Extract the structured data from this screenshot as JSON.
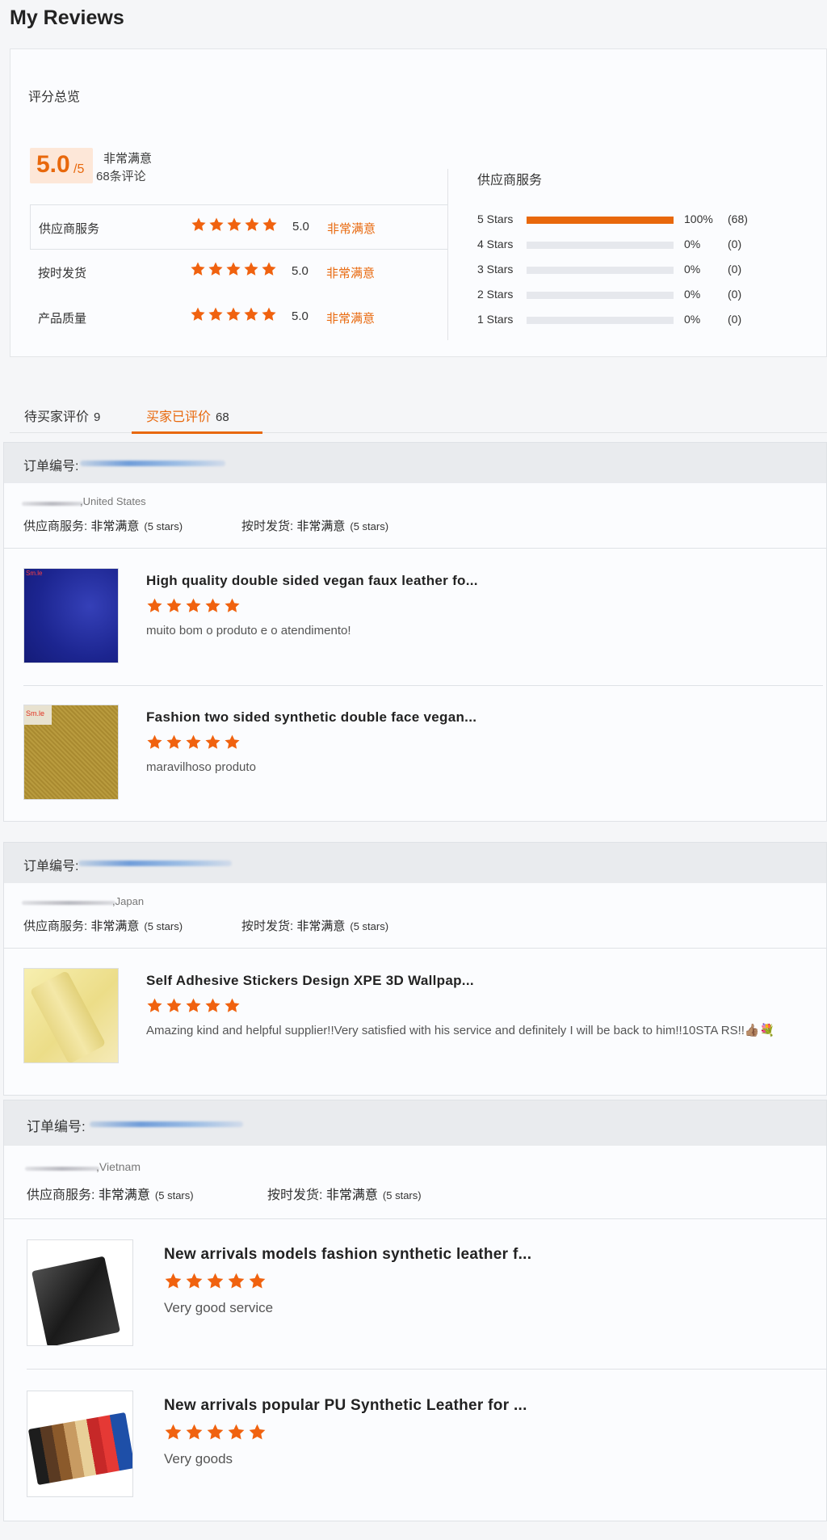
{
  "page": {
    "title": "My Reviews"
  },
  "overview": {
    "heading": "评分总览",
    "score": "5.0",
    "score_max": "/5",
    "score_text": "非常满意",
    "review_count": "68条评论",
    "rows": [
      {
        "label": "供应商服务",
        "score": "5.0",
        "status": "非常满意",
        "stars": 5
      },
      {
        "label": "按时发货",
        "score": "5.0",
        "status": "非常满意",
        "stars": 5
      },
      {
        "label": "产品质量",
        "score": "5.0",
        "status": "非常满意",
        "stars": 5
      }
    ],
    "distribution_title": "供应商服务",
    "distribution": [
      {
        "label": "5 Stars",
        "percent": "100%",
        "count": "(68)",
        "fraction": 1.0
      },
      {
        "label": "4 Stars",
        "percent": "0%",
        "count": "(0)",
        "fraction": 0
      },
      {
        "label": "3 Stars",
        "percent": "0%",
        "count": "(0)",
        "fraction": 0
      },
      {
        "label": "2 Stars",
        "percent": "0%",
        "count": "(0)",
        "fraction": 0
      },
      {
        "label": "1 Stars",
        "percent": "0%",
        "count": "(0)",
        "fraction": 0
      }
    ]
  },
  "tabs": [
    {
      "label": "待买家评价",
      "count": "9",
      "active": false
    },
    {
      "label": "买家已评价",
      "count": "68",
      "active": true
    }
  ],
  "orders": [
    {
      "order_label": "订单编号:",
      "country": "United States",
      "supplier_service_key": "供应商服务:",
      "supplier_service_val": "非常满意",
      "supplier_service_stars": "(5 stars)",
      "on_time_key": "按时发货:",
      "on_time_val": "非常满意",
      "on_time_stars": "(5 stars)",
      "products": [
        {
          "title": "High quality double sided vegan faux leather fo...",
          "stars": 5,
          "comment": "muito bom o produto e o atendimento!",
          "thumb_label": "Sm.le"
        },
        {
          "title": "Fashion two sided synthetic double face vegan...",
          "stars": 5,
          "comment": "maravilhoso produto",
          "thumb_label": "Sm.le"
        }
      ]
    },
    {
      "order_label": "订单编号:",
      "country": "Japan",
      "supplier_service_key": "供应商服务:",
      "supplier_service_val": "非常满意",
      "supplier_service_stars": "(5 stars)",
      "on_time_key": "按时发货:",
      "on_time_val": "非常满意",
      "on_time_stars": "(5 stars)",
      "products": [
        {
          "title": "Self Adhesive Stickers Design XPE 3D Wallpap...",
          "stars": 5,
          "comment": "Amazing kind and helpful supplier!!Very satisfied with his service and definitely I will be back to him!!10STA RS!!👍🏽💐"
        }
      ]
    },
    {
      "order_label": "订单编号:",
      "country": "Vietnam",
      "supplier_service_key": "供应商服务:",
      "supplier_service_val": "非常满意",
      "supplier_service_stars": "(5 stars)",
      "on_time_key": "按时发货:",
      "on_time_val": "非常满意",
      "on_time_stars": "(5 stars)",
      "products": [
        {
          "title": "New arrivals models fashion synthetic leather f...",
          "stars": 5,
          "comment": "Very good service"
        },
        {
          "title": "New arrivals popular PU Synthetic Leather for ...",
          "stars": 5,
          "comment": "Very goods"
        }
      ]
    }
  ],
  "colors": {
    "accent": "#e8680c",
    "star": "#f0620f"
  },
  "icons": {
    "star": "star-icon"
  }
}
